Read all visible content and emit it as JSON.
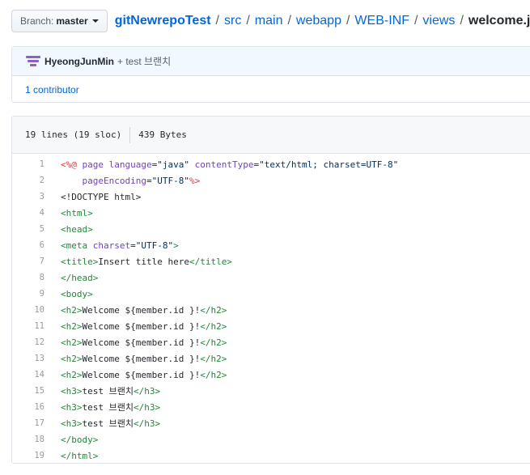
{
  "branch": {
    "label": "Branch:",
    "name": "master"
  },
  "breadcrumb": {
    "repo": "gitNewrepoTest",
    "separator": "/",
    "dirs": [
      "src",
      "main",
      "webapp",
      "WEB-INF",
      "views"
    ],
    "file": "welcome.jsp"
  },
  "commit": {
    "author": "HyeongJunMin",
    "message": "+ test 브랜치",
    "contributors": "1 contributor"
  },
  "file": {
    "lines_info": "19 lines (19 sloc)",
    "size": "439 Bytes"
  },
  "code_lines": [
    [
      [
        "kw",
        "<%@ "
      ],
      [
        "at",
        "page "
      ],
      [
        "at",
        "language"
      ],
      [
        "tx",
        "="
      ],
      [
        "st",
        "\"java\" "
      ],
      [
        "at",
        "contentType"
      ],
      [
        "tx",
        "="
      ],
      [
        "st",
        "\"text/html; charset=UTF-8\""
      ]
    ],
    [
      [
        "tx",
        "    "
      ],
      [
        "at",
        "pageEncoding"
      ],
      [
        "tx",
        "="
      ],
      [
        "st",
        "\"UTF-8\""
      ],
      [
        "kw",
        "%>"
      ]
    ],
    [
      [
        "tx",
        "<!DOCTYPE html>"
      ]
    ],
    [
      [
        "tg",
        "<html>"
      ]
    ],
    [
      [
        "tg",
        "<head>"
      ]
    ],
    [
      [
        "tg",
        "<meta "
      ],
      [
        "at",
        "charset"
      ],
      [
        "tx",
        "="
      ],
      [
        "st",
        "\"UTF-8\""
      ],
      [
        "tg",
        ">"
      ]
    ],
    [
      [
        "tg",
        "<title>"
      ],
      [
        "tx",
        "Insert title here"
      ],
      [
        "tg",
        "</title>"
      ]
    ],
    [
      [
        "tg",
        "</head>"
      ]
    ],
    [
      [
        "tg",
        "<body>"
      ]
    ],
    [
      [
        "tg",
        "<h2>"
      ],
      [
        "tx",
        "Welcome ${member.id }!"
      ],
      [
        "tg",
        "</h2>"
      ]
    ],
    [
      [
        "tg",
        "<h2>"
      ],
      [
        "tx",
        "Welcome ${member.id }!"
      ],
      [
        "tg",
        "</h2>"
      ]
    ],
    [
      [
        "tg",
        "<h2>"
      ],
      [
        "tx",
        "Welcome ${member.id }!"
      ],
      [
        "tg",
        "</h2>"
      ]
    ],
    [
      [
        "tg",
        "<h2>"
      ],
      [
        "tx",
        "Welcome ${member.id }!"
      ],
      [
        "tg",
        "</h2>"
      ]
    ],
    [
      [
        "tg",
        "<h2>"
      ],
      [
        "tx",
        "Welcome ${member.id }!"
      ],
      [
        "tg",
        "</h2>"
      ]
    ],
    [
      [
        "tg",
        "<h3>"
      ],
      [
        "tx",
        "test 브랜치"
      ],
      [
        "tg",
        "</h3>"
      ]
    ],
    [
      [
        "tg",
        "<h3>"
      ],
      [
        "tx",
        "test 브랜치"
      ],
      [
        "tg",
        "</h3>"
      ]
    ],
    [
      [
        "tg",
        "<h3>"
      ],
      [
        "tx",
        "test 브랜치"
      ],
      [
        "tg",
        "</h3>"
      ]
    ],
    [
      [
        "tg",
        "</body>"
      ]
    ],
    [
      [
        "tg",
        "</html>"
      ]
    ]
  ],
  "colors": {
    "link": "#0366d6",
    "keyword": "#d73a49",
    "attribute": "#6f42c1",
    "string": "#032f62",
    "tag": "#22863a",
    "avatar": "#8e5fc8"
  }
}
